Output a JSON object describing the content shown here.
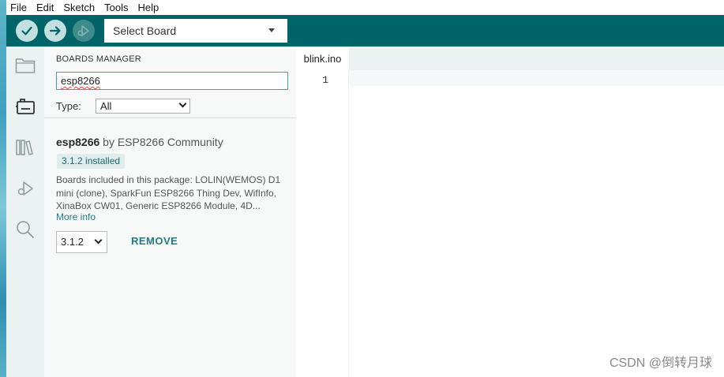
{
  "menu": [
    "File",
    "Edit",
    "Sketch",
    "Tools",
    "Help"
  ],
  "toolbar": {
    "verify_icon": "checkmark-icon",
    "upload_icon": "arrow-right-icon",
    "debug_icon": "debug-icon",
    "board_select_label": "Select Board"
  },
  "sidebar": {
    "icons": [
      "folder-icon",
      "boards-manager-icon",
      "library-icon",
      "debug-icon",
      "search-icon"
    ]
  },
  "boards_manager": {
    "title": "BOARDS MANAGER",
    "search_value": "esp8266",
    "type_label": "Type:",
    "type_value": "All",
    "package": {
      "name": "esp8266",
      "by": "by ESP8266 Community",
      "installed_badge": "3.1.2 installed",
      "description": "Boards included in this package: LOLIN(WEMOS) D1 mini (clone), SparkFun ESP8266 Thing Dev, WifInfo, XinaBox CW01, Generic ESP8266 Module, 4D...",
      "more_info": "More info",
      "version_value": "3.1.2",
      "remove_label": "REMOVE"
    }
  },
  "editor": {
    "tab_name": "blink.ino",
    "line_number": "1"
  },
  "watermark": "CSDN @倒转月球",
  "colors": {
    "toolbar": "#006468",
    "accent": "#1f7c82",
    "sidebar": "#ecf1f1",
    "panel": "#f7f9f9"
  }
}
